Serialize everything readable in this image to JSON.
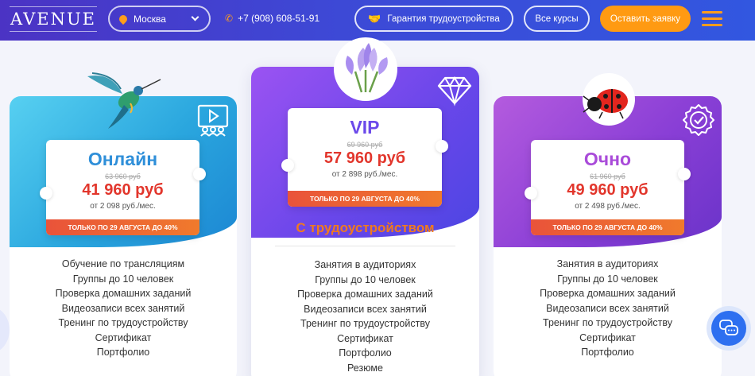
{
  "header": {
    "logo": "AVENUE",
    "city": "Москва",
    "phone": "+7 (908) 608-51-91",
    "guarantee_label": "Гарантия трудоустройства",
    "courses_label": "Все курсы",
    "order_label": "Оставить заявку"
  },
  "plans": [
    {
      "title": "Онлайн",
      "old_price": "63 960 руб",
      "price": "41 960 руб",
      "monthly": "от 2 098 руб./мес.",
      "promo": "ТОЛЬКО ПО 29 АВГУСТА ДО 40%",
      "features": [
        "Обучение по трансляциям",
        "Группы до 10 человек",
        "Проверка домашних заданий",
        "Видеозаписи всех занятий",
        "Тренинг по трудоустройству",
        "Сертификат",
        "Портфолио"
      ]
    },
    {
      "title": "VIP",
      "old_price": "69 960 руб",
      "price": "57 960 руб",
      "monthly": "от 2 898 руб./мес.",
      "promo": "ТОЛЬКО ПО 29 АВГУСТА ДО 40%",
      "subtitle": "С трудоустройством",
      "features": [
        "Занятия в аудиториях",
        "Группы до 10 человек",
        "Проверка домашних заданий",
        "Видеозаписи всех занятий",
        "Тренинг по трудоустройству",
        "Сертификат",
        "Портфолио",
        "Резюме"
      ]
    },
    {
      "title": "Очно",
      "old_price": "61 960 руб",
      "price": "49 960 руб",
      "monthly": "от 2 498 руб./мес.",
      "promo": "ТОЛЬКО ПО 29 АВГУСТА ДО 40%",
      "features": [
        "Занятия в аудиториях",
        "Группы до 10 человек",
        "Проверка домашних заданий",
        "Видеозаписи всех занятий",
        "Тренинг по трудоустройству",
        "Сертификат",
        "Портфолио"
      ]
    }
  ],
  "icons": {
    "city": "map-pin-icon",
    "phone": "phone-icon",
    "guarantee": "handshake-icon",
    "menu": "hamburger-menu-icon",
    "online": "video-lesson-icon",
    "vip": "diamond-icon",
    "ochno": "badge-check-icon",
    "chat": "chat-icon"
  },
  "colors": {
    "header_start": "#4b33c4",
    "header_end": "#3257e0",
    "accent_orange": "#ff9a12",
    "price_red": "#e2362c",
    "online_blue": "#2f8fd9",
    "vip_purple": "#6b49ea",
    "ochno_violet": "#a94bd9"
  }
}
